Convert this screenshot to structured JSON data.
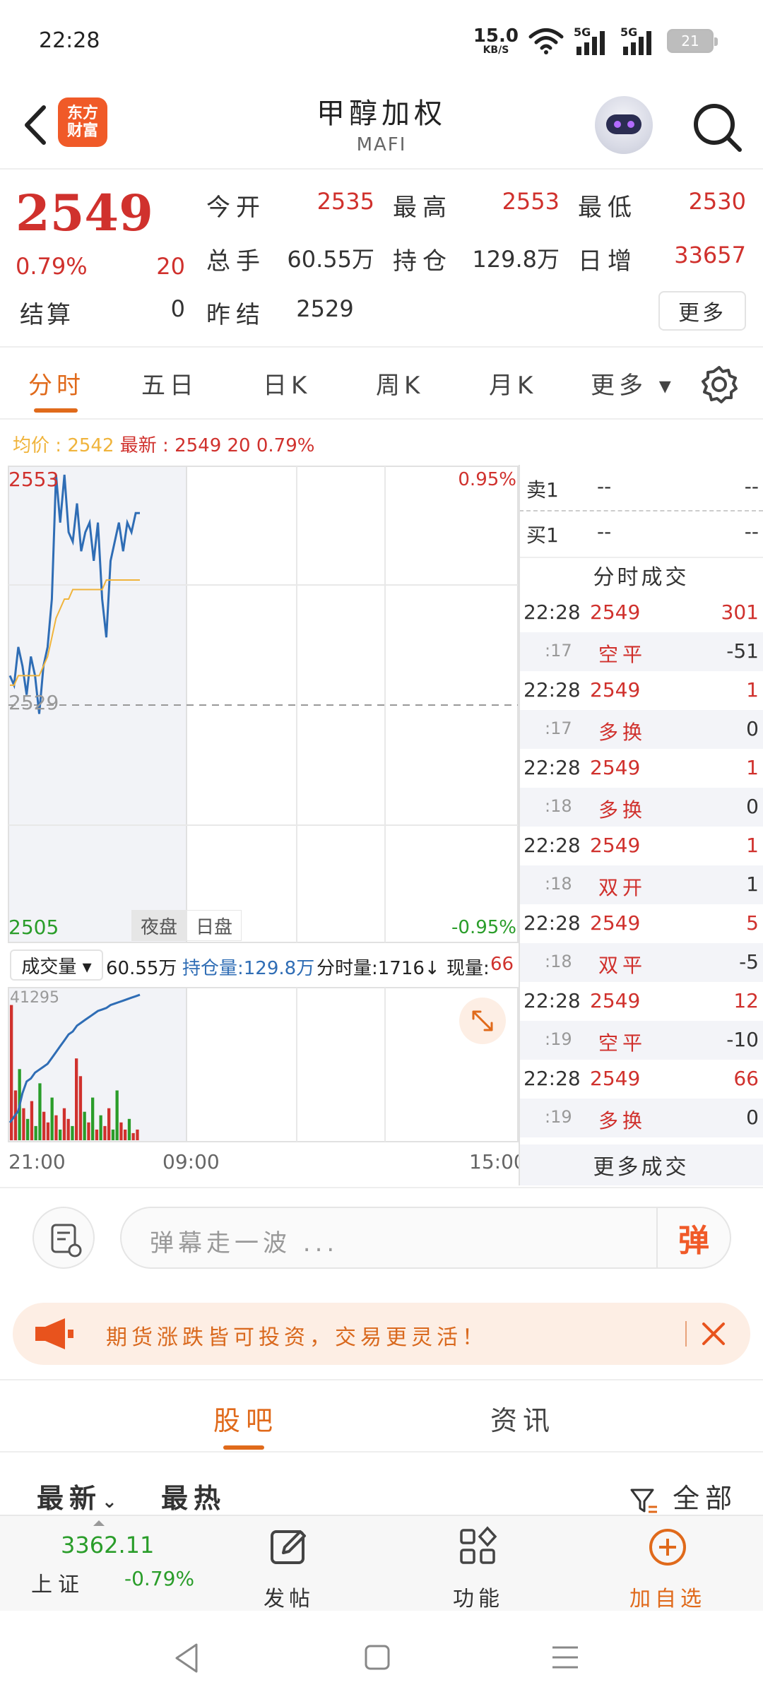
{
  "status_bar": {
    "time": "22:28",
    "net_speed": "15.0",
    "net_unit": "KB/S",
    "signal1": "5G",
    "signal2": "5G",
    "battery": "21"
  },
  "header": {
    "title": "甲醇加权",
    "subtitle": "MAFI",
    "logo_line1": "东方",
    "logo_line2": "财富"
  },
  "quote": {
    "last_price": "2549",
    "change_pct": "0.79%",
    "change_abs": "20",
    "settle_label": "结算",
    "settle_value": "0",
    "open_label": "今开",
    "open_value": "2535",
    "high_label": "最高",
    "high_value": "2553",
    "low_label": "最低",
    "low_value": "2530",
    "volume_label": "总手",
    "volume_value": "60.55万",
    "oi_label": "持仓",
    "oi_value": "129.8万",
    "daily_inc_label": "日增",
    "daily_inc_value": "33657",
    "prev_settle_label": "昨结",
    "prev_settle_value": "2529",
    "more_label": "更多"
  },
  "tabs": [
    {
      "label": "分时"
    },
    {
      "label": "五日"
    },
    {
      "label": "日K"
    },
    {
      "label": "周K"
    },
    {
      "label": "月K"
    },
    {
      "label": "更多 ▾"
    }
  ],
  "info_line": {
    "avg_label": "均价",
    "avg_value": "2542",
    "latest_label": "最新",
    "latest_value": "2549 20 0.79%"
  },
  "chart": {
    "price_high": "2553",
    "price_mid": "2529",
    "price_low": "2505",
    "pct_high": "0.95%",
    "pct_low": "-0.95%",
    "night_label": "夜盘",
    "day_label": "日盘",
    "vol_axis_max": "41295",
    "time_start": "21:00",
    "time_mid": "09:00",
    "time_end": "15:00"
  },
  "volume_info": {
    "selector": "成交量 ▾",
    "total": "60.55万",
    "oi": "持仓量:129.8万",
    "min_vol": "分时量:1716↓",
    "now_label": "现量:",
    "now_value": "66"
  },
  "chart_data": {
    "type": "line",
    "title": "",
    "xlabel": "",
    "ylabel": "",
    "x_ticks": [
      "21:00",
      "09:00",
      "15:00"
    ],
    "ylim": [
      2505,
      2553
    ],
    "series": [
      {
        "values": [
          2532,
          2531,
          2535,
          2533,
          2530,
          2534,
          2532,
          2528,
          2533,
          2535,
          2540,
          2553,
          2548,
          2553,
          2547,
          2546,
          2550,
          2545,
          2547,
          2548,
          2544,
          2548,
          2540,
          2536,
          2544,
          2546,
          2548,
          2545,
          2548,
          2547,
          2549,
          2549
        ]
      },
      {
        "values": [
          2531,
          2531,
          2532,
          2532,
          2532,
          2532,
          2532,
          2532,
          2533,
          2534,
          2536,
          2538,
          2539,
          2540,
          2540,
          2541,
          2541,
          2541,
          2541,
          2541,
          2541,
          2541,
          2541,
          2542,
          2542,
          2542,
          2542,
          2542,
          2542,
          2542,
          2542,
          2542
        ]
      }
    ],
    "volume_ylim": [
      0,
      41295
    ],
    "volume_bars": [
      {
        "v": 38000,
        "up": true
      },
      {
        "v": 14000,
        "up": true
      },
      {
        "v": 20000,
        "up": false
      },
      {
        "v": 9000,
        "up": true
      },
      {
        "v": 6000,
        "up": false
      },
      {
        "v": 11000,
        "up": true
      },
      {
        "v": 4000,
        "up": false
      },
      {
        "v": 16000,
        "up": false
      },
      {
        "v": 8000,
        "up": true
      },
      {
        "v": 5000,
        "up": true
      },
      {
        "v": 12000,
        "up": false
      },
      {
        "v": 7000,
        "up": true
      },
      {
        "v": 3000,
        "up": false
      },
      {
        "v": 9000,
        "up": true
      },
      {
        "v": 6000,
        "up": true
      },
      {
        "v": 4000,
        "up": false
      },
      {
        "v": 23000,
        "up": true
      },
      {
        "v": 18000,
        "up": true
      },
      {
        "v": 8000,
        "up": false
      },
      {
        "v": 5000,
        "up": true
      },
      {
        "v": 12000,
        "up": false
      },
      {
        "v": 3000,
        "up": true
      },
      {
        "v": 7000,
        "up": false
      },
      {
        "v": 4000,
        "up": true
      },
      {
        "v": 9000,
        "up": true
      },
      {
        "v": 3000,
        "up": false
      },
      {
        "v": 14000,
        "up": false
      },
      {
        "v": 5000,
        "up": true
      },
      {
        "v": 3000,
        "up": true
      },
      {
        "v": 6000,
        "up": false
      },
      {
        "v": 2000,
        "up": true
      },
      {
        "v": 3000,
        "up": true
      }
    ],
    "open_interest_trend": [
      0.12,
      0.16,
      0.2,
      0.32,
      0.4,
      0.42,
      0.46,
      0.48,
      0.5,
      0.52,
      0.56,
      0.6,
      0.64,
      0.68,
      0.72,
      0.74,
      0.78,
      0.8,
      0.82,
      0.84,
      0.86,
      0.88,
      0.89,
      0.9,
      0.92,
      0.93,
      0.94,
      0.95,
      0.96,
      0.97,
      0.98,
      0.99
    ]
  },
  "orderbook": {
    "sell_label": "卖1",
    "sell_price": "--",
    "sell_vol": "--",
    "buy_label": "买1",
    "buy_price": "--",
    "buy_vol": "--"
  },
  "trades_title": "分时成交",
  "trades": [
    {
      "time": "22:28",
      "price": "2549",
      "vol": "301",
      "sec": ":17",
      "type": "空平",
      "oi_change": "-51"
    },
    {
      "time": "22:28",
      "price": "2549",
      "vol": "1",
      "sec": ":17",
      "type": "多换",
      "oi_change": "0"
    },
    {
      "time": "22:28",
      "price": "2549",
      "vol": "1",
      "sec": ":18",
      "type": "多换",
      "oi_change": "0"
    },
    {
      "time": "22:28",
      "price": "2549",
      "vol": "1",
      "sec": ":18",
      "type": "双开",
      "oi_change": "1"
    },
    {
      "time": "22:28",
      "price": "2549",
      "vol": "5",
      "sec": ":18",
      "type": "双平",
      "oi_change": "-5"
    },
    {
      "time": "22:28",
      "price": "2549",
      "vol": "12",
      "sec": ":19",
      "type": "空平",
      "oi_change": "-10"
    },
    {
      "time": "22:28",
      "price": "2549",
      "vol": "66",
      "sec": ":19",
      "type": "多换",
      "oi_change": "0"
    }
  ],
  "more_trades": "更多成交",
  "comment": {
    "placeholder": "弹幕走一波 ...",
    "danmu_label": "弹"
  },
  "promo": {
    "text": "期货涨跌皆可投资，交易更灵活！"
  },
  "bottom_tabs": [
    {
      "label": "股吧"
    },
    {
      "label": "资讯"
    }
  ],
  "sort": {
    "latest": "最新",
    "hot": "最热",
    "filter": "全部"
  },
  "toolbar": {
    "index_value": "3362.11",
    "index_name": "上证",
    "index_change": "-0.79%",
    "post_label": "发帖",
    "func_label": "功能",
    "add_label": "加自选"
  },
  "colors": {
    "up": "#d0312d",
    "down": "#2a9d2a",
    "accent": "#e06a1b",
    "price_line": "#2f6db5",
    "avg_line": "#f0b43c"
  }
}
